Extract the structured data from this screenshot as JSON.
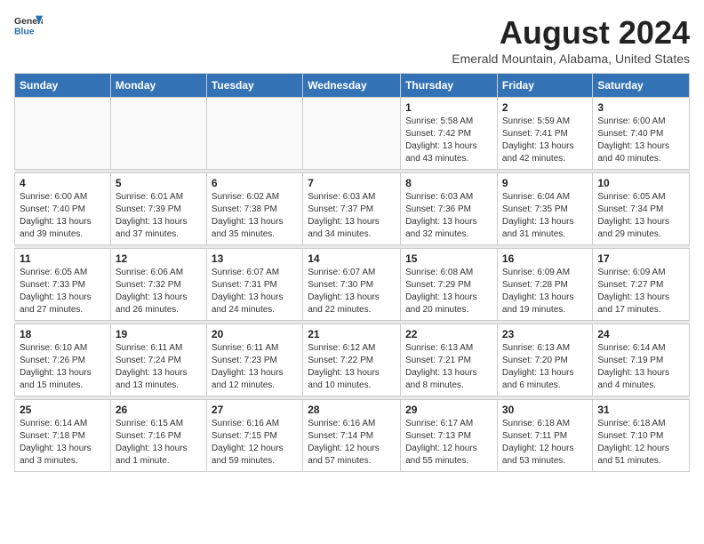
{
  "header": {
    "logo_general": "General",
    "logo_blue": "Blue",
    "month_title": "August 2024",
    "location": "Emerald Mountain, Alabama, United States"
  },
  "weekdays": [
    "Sunday",
    "Monday",
    "Tuesday",
    "Wednesday",
    "Thursday",
    "Friday",
    "Saturday"
  ],
  "weeks": [
    [
      {
        "day": "",
        "info": ""
      },
      {
        "day": "",
        "info": ""
      },
      {
        "day": "",
        "info": ""
      },
      {
        "day": "",
        "info": ""
      },
      {
        "day": "1",
        "info": "Sunrise: 5:58 AM\nSunset: 7:42 PM\nDaylight: 13 hours\nand 43 minutes."
      },
      {
        "day": "2",
        "info": "Sunrise: 5:59 AM\nSunset: 7:41 PM\nDaylight: 13 hours\nand 42 minutes."
      },
      {
        "day": "3",
        "info": "Sunrise: 6:00 AM\nSunset: 7:40 PM\nDaylight: 13 hours\nand 40 minutes."
      }
    ],
    [
      {
        "day": "4",
        "info": "Sunrise: 6:00 AM\nSunset: 7:40 PM\nDaylight: 13 hours\nand 39 minutes."
      },
      {
        "day": "5",
        "info": "Sunrise: 6:01 AM\nSunset: 7:39 PM\nDaylight: 13 hours\nand 37 minutes."
      },
      {
        "day": "6",
        "info": "Sunrise: 6:02 AM\nSunset: 7:38 PM\nDaylight: 13 hours\nand 35 minutes."
      },
      {
        "day": "7",
        "info": "Sunrise: 6:03 AM\nSunset: 7:37 PM\nDaylight: 13 hours\nand 34 minutes."
      },
      {
        "day": "8",
        "info": "Sunrise: 6:03 AM\nSunset: 7:36 PM\nDaylight: 13 hours\nand 32 minutes."
      },
      {
        "day": "9",
        "info": "Sunrise: 6:04 AM\nSunset: 7:35 PM\nDaylight: 13 hours\nand 31 minutes."
      },
      {
        "day": "10",
        "info": "Sunrise: 6:05 AM\nSunset: 7:34 PM\nDaylight: 13 hours\nand 29 minutes."
      }
    ],
    [
      {
        "day": "11",
        "info": "Sunrise: 6:05 AM\nSunset: 7:33 PM\nDaylight: 13 hours\nand 27 minutes."
      },
      {
        "day": "12",
        "info": "Sunrise: 6:06 AM\nSunset: 7:32 PM\nDaylight: 13 hours\nand 26 minutes."
      },
      {
        "day": "13",
        "info": "Sunrise: 6:07 AM\nSunset: 7:31 PM\nDaylight: 13 hours\nand 24 minutes."
      },
      {
        "day": "14",
        "info": "Sunrise: 6:07 AM\nSunset: 7:30 PM\nDaylight: 13 hours\nand 22 minutes."
      },
      {
        "day": "15",
        "info": "Sunrise: 6:08 AM\nSunset: 7:29 PM\nDaylight: 13 hours\nand 20 minutes."
      },
      {
        "day": "16",
        "info": "Sunrise: 6:09 AM\nSunset: 7:28 PM\nDaylight: 13 hours\nand 19 minutes."
      },
      {
        "day": "17",
        "info": "Sunrise: 6:09 AM\nSunset: 7:27 PM\nDaylight: 13 hours\nand 17 minutes."
      }
    ],
    [
      {
        "day": "18",
        "info": "Sunrise: 6:10 AM\nSunset: 7:26 PM\nDaylight: 13 hours\nand 15 minutes."
      },
      {
        "day": "19",
        "info": "Sunrise: 6:11 AM\nSunset: 7:24 PM\nDaylight: 13 hours\nand 13 minutes."
      },
      {
        "day": "20",
        "info": "Sunrise: 6:11 AM\nSunset: 7:23 PM\nDaylight: 13 hours\nand 12 minutes."
      },
      {
        "day": "21",
        "info": "Sunrise: 6:12 AM\nSunset: 7:22 PM\nDaylight: 13 hours\nand 10 minutes."
      },
      {
        "day": "22",
        "info": "Sunrise: 6:13 AM\nSunset: 7:21 PM\nDaylight: 13 hours\nand 8 minutes."
      },
      {
        "day": "23",
        "info": "Sunrise: 6:13 AM\nSunset: 7:20 PM\nDaylight: 13 hours\nand 6 minutes."
      },
      {
        "day": "24",
        "info": "Sunrise: 6:14 AM\nSunset: 7:19 PM\nDaylight: 13 hours\nand 4 minutes."
      }
    ],
    [
      {
        "day": "25",
        "info": "Sunrise: 6:14 AM\nSunset: 7:18 PM\nDaylight: 13 hours\nand 3 minutes."
      },
      {
        "day": "26",
        "info": "Sunrise: 6:15 AM\nSunset: 7:16 PM\nDaylight: 13 hours\nand 1 minute."
      },
      {
        "day": "27",
        "info": "Sunrise: 6:16 AM\nSunset: 7:15 PM\nDaylight: 12 hours\nand 59 minutes."
      },
      {
        "day": "28",
        "info": "Sunrise: 6:16 AM\nSunset: 7:14 PM\nDaylight: 12 hours\nand 57 minutes."
      },
      {
        "day": "29",
        "info": "Sunrise: 6:17 AM\nSunset: 7:13 PM\nDaylight: 12 hours\nand 55 minutes."
      },
      {
        "day": "30",
        "info": "Sunrise: 6:18 AM\nSunset: 7:11 PM\nDaylight: 12 hours\nand 53 minutes."
      },
      {
        "day": "31",
        "info": "Sunrise: 6:18 AM\nSunset: 7:10 PM\nDaylight: 12 hours\nand 51 minutes."
      }
    ]
  ]
}
